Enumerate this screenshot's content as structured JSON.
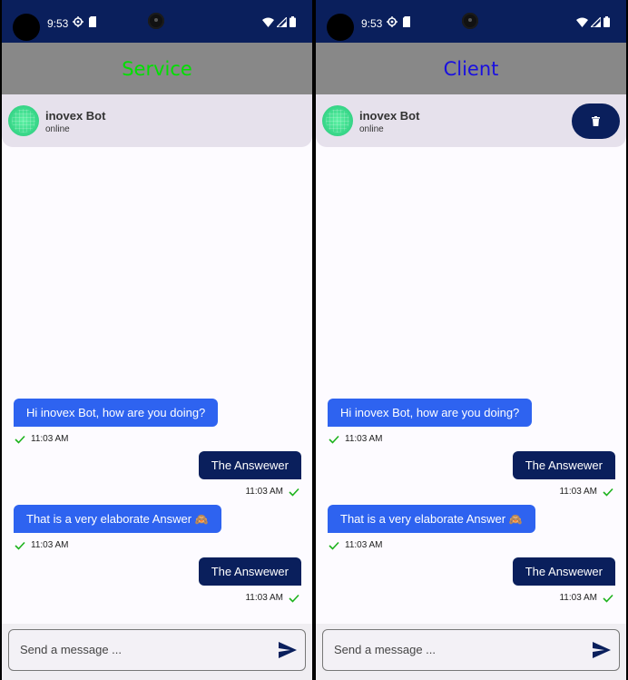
{
  "status_bar": {
    "time": "9:53"
  },
  "phones": {
    "left": {
      "title": "Service"
    },
    "right": {
      "title": "Client"
    }
  },
  "chat": {
    "contact_name": "inovex Bot",
    "contact_status": "online",
    "messages": [
      {
        "direction": "incoming",
        "text": "Hi inovex Bot, how are you doing?",
        "time": "11:03 AM"
      },
      {
        "direction": "outgoing",
        "text": "The Answewer",
        "time": "11:03 AM"
      },
      {
        "direction": "incoming",
        "text": "That is a very elaborate Answer",
        "emoji": "🙈",
        "time": "11:03 AM"
      },
      {
        "direction": "outgoing",
        "text": "The Answewer",
        "time": "11:03 AM"
      }
    ]
  },
  "composer": {
    "placeholder": "Send a message ..."
  },
  "colors": {
    "status_bar_bg": "#0a1f5c",
    "app_bar_bg": "#888888",
    "service_title": "#00e000",
    "client_title": "#1a10e0",
    "incoming_bubble": "#2e63f0",
    "outgoing_bubble": "#0a1f5c",
    "check_green": "#1db31d"
  },
  "icons": {
    "status_left": [
      "settings-gear-icon",
      "sd-card-icon"
    ],
    "status_right": [
      "wifi-icon",
      "cell-signal-icon",
      "battery-icon"
    ],
    "delete": "trash-icon",
    "send": "send-icon",
    "read": "check-icon"
  }
}
